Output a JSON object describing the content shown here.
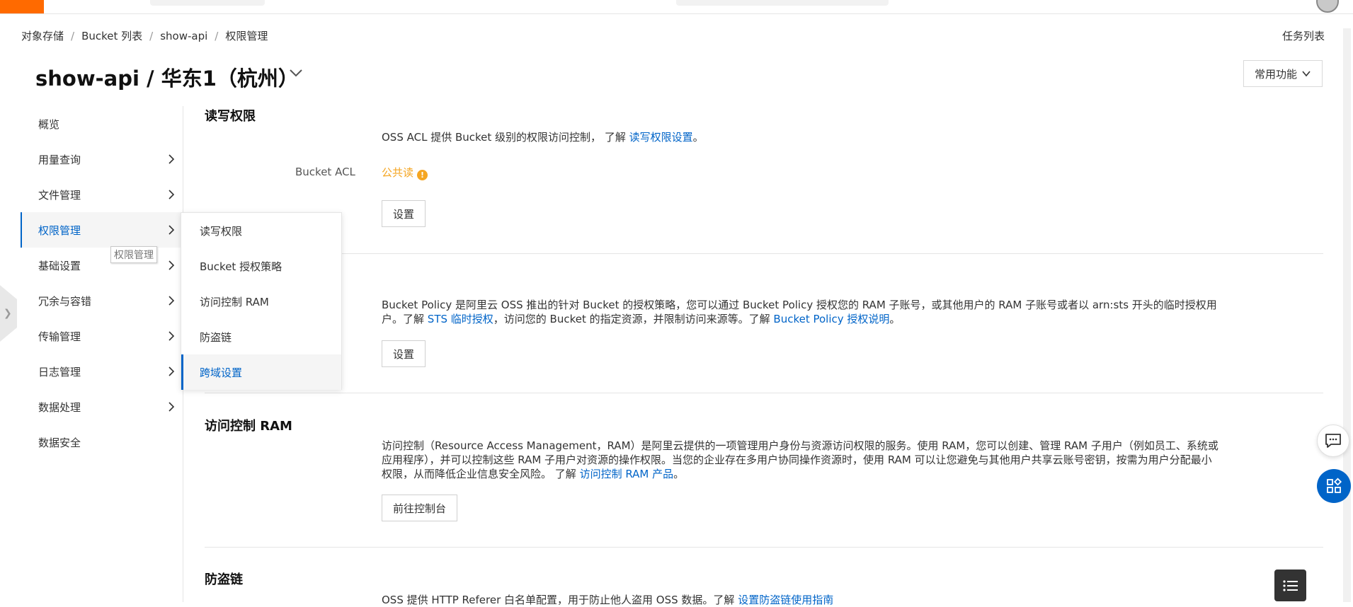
{
  "breadcrumb": [
    "对象存储",
    "Bucket 列表",
    "show-api",
    "权限管理"
  ],
  "header": {
    "title": "show-api / 华东1（杭州）",
    "task_list": "任务列表",
    "common_functions": "常用功能"
  },
  "sidebar": {
    "items": [
      {
        "label": "概览"
      },
      {
        "label": "用量查询"
      },
      {
        "label": "文件管理"
      },
      {
        "label": "权限管理"
      },
      {
        "label": "基础设置"
      },
      {
        "label": "冗余与容错"
      },
      {
        "label": "传输管理"
      },
      {
        "label": "日志管理"
      },
      {
        "label": "数据处理"
      },
      {
        "label": "数据安全"
      }
    ],
    "tooltip": "权限管理"
  },
  "submenu": {
    "items": [
      {
        "label": "读写权限"
      },
      {
        "label": "Bucket 授权策略"
      },
      {
        "label": "访问控制 RAM"
      },
      {
        "label": "防盗链"
      },
      {
        "label": "跨域设置"
      }
    ]
  },
  "sections": {
    "rw": {
      "title": "读写权限",
      "desc_text": "OSS ACL 提供 Bucket 级别的权限访问控制， 了解",
      "desc_link": "读写权限设置",
      "desc_end": "。",
      "acl_label": "Bucket ACL",
      "acl_value": "公共读",
      "button": "设置"
    },
    "policy": {
      "line1": "Bucket Policy 是阿里云 OSS 推出的针对 Bucket 的授权策略，您可以通过 Bucket Policy 授权您的 RAM 子账号，或其他用户的 RAM 子账号或者以 arn:sts 开头的临时授权用",
      "line2_a": "户。了解",
      "link1": "STS 临时授权",
      "line2_b": "，访问您的 Bucket 的指定资源，并限制访问来源等。了解",
      "link2": "Bucket Policy 授权说明",
      "line2_c": "。",
      "button": "设置"
    },
    "ram": {
      "title": "访问控制 RAM",
      "line1": "访问控制（Resource Access Management，RAM）是阿里云提供的一项管理用户身份与资源访问权限的服务。使用 RAM，您可以创建、管理 RAM 子用户（例如员工、系统或",
      "line2": "应用程序），并可以控制这些 RAM 子用户对资源的操作权限。当您的企业存在多用户协同操作资源时，使用 RAM 可以让您避免与其他用户共享云账号密钥，按需为用户分配最小",
      "line3_a": "权限，从而降低企业信息安全风险。 了解",
      "link": "访问控制 RAM 产品",
      "line3_c": "。",
      "button": "前往控制台"
    },
    "referer": {
      "title": "防盗链",
      "desc_text": "OSS 提供 HTTP Referer 白名单配置，用于防止他人盗用 OSS 数据。了解",
      "desc_link": "设置防盗链使用指南"
    }
  },
  "colors": {
    "accent": "#0064c8",
    "brand": "#ff6a00",
    "warning": "#f5a623"
  },
  "icons": [
    "chevron-down-icon",
    "chevron-right-icon",
    "warning-icon",
    "chat-icon",
    "apps-icon",
    "menu-icon",
    "avatar"
  ]
}
